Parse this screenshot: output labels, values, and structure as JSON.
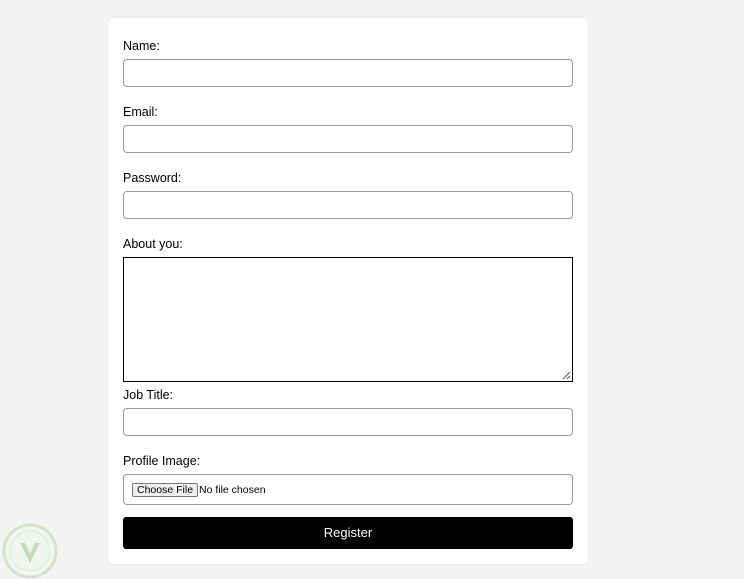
{
  "form": {
    "fields": [
      {
        "label": "Name:",
        "value": ""
      },
      {
        "label": "Email:",
        "value": ""
      },
      {
        "label": "Password:",
        "value": ""
      },
      {
        "label": "About you:",
        "value": ""
      },
      {
        "label": "Job Title:",
        "value": ""
      },
      {
        "label": "Profile Image:",
        "button_label": "Choose File",
        "status": "No file chosen"
      }
    ],
    "submit_label": "Register"
  },
  "colors": {
    "page_background": "#f4f4f4",
    "card_background": "#ffffff",
    "button_background": "#000000",
    "button_text": "#ffffff"
  }
}
